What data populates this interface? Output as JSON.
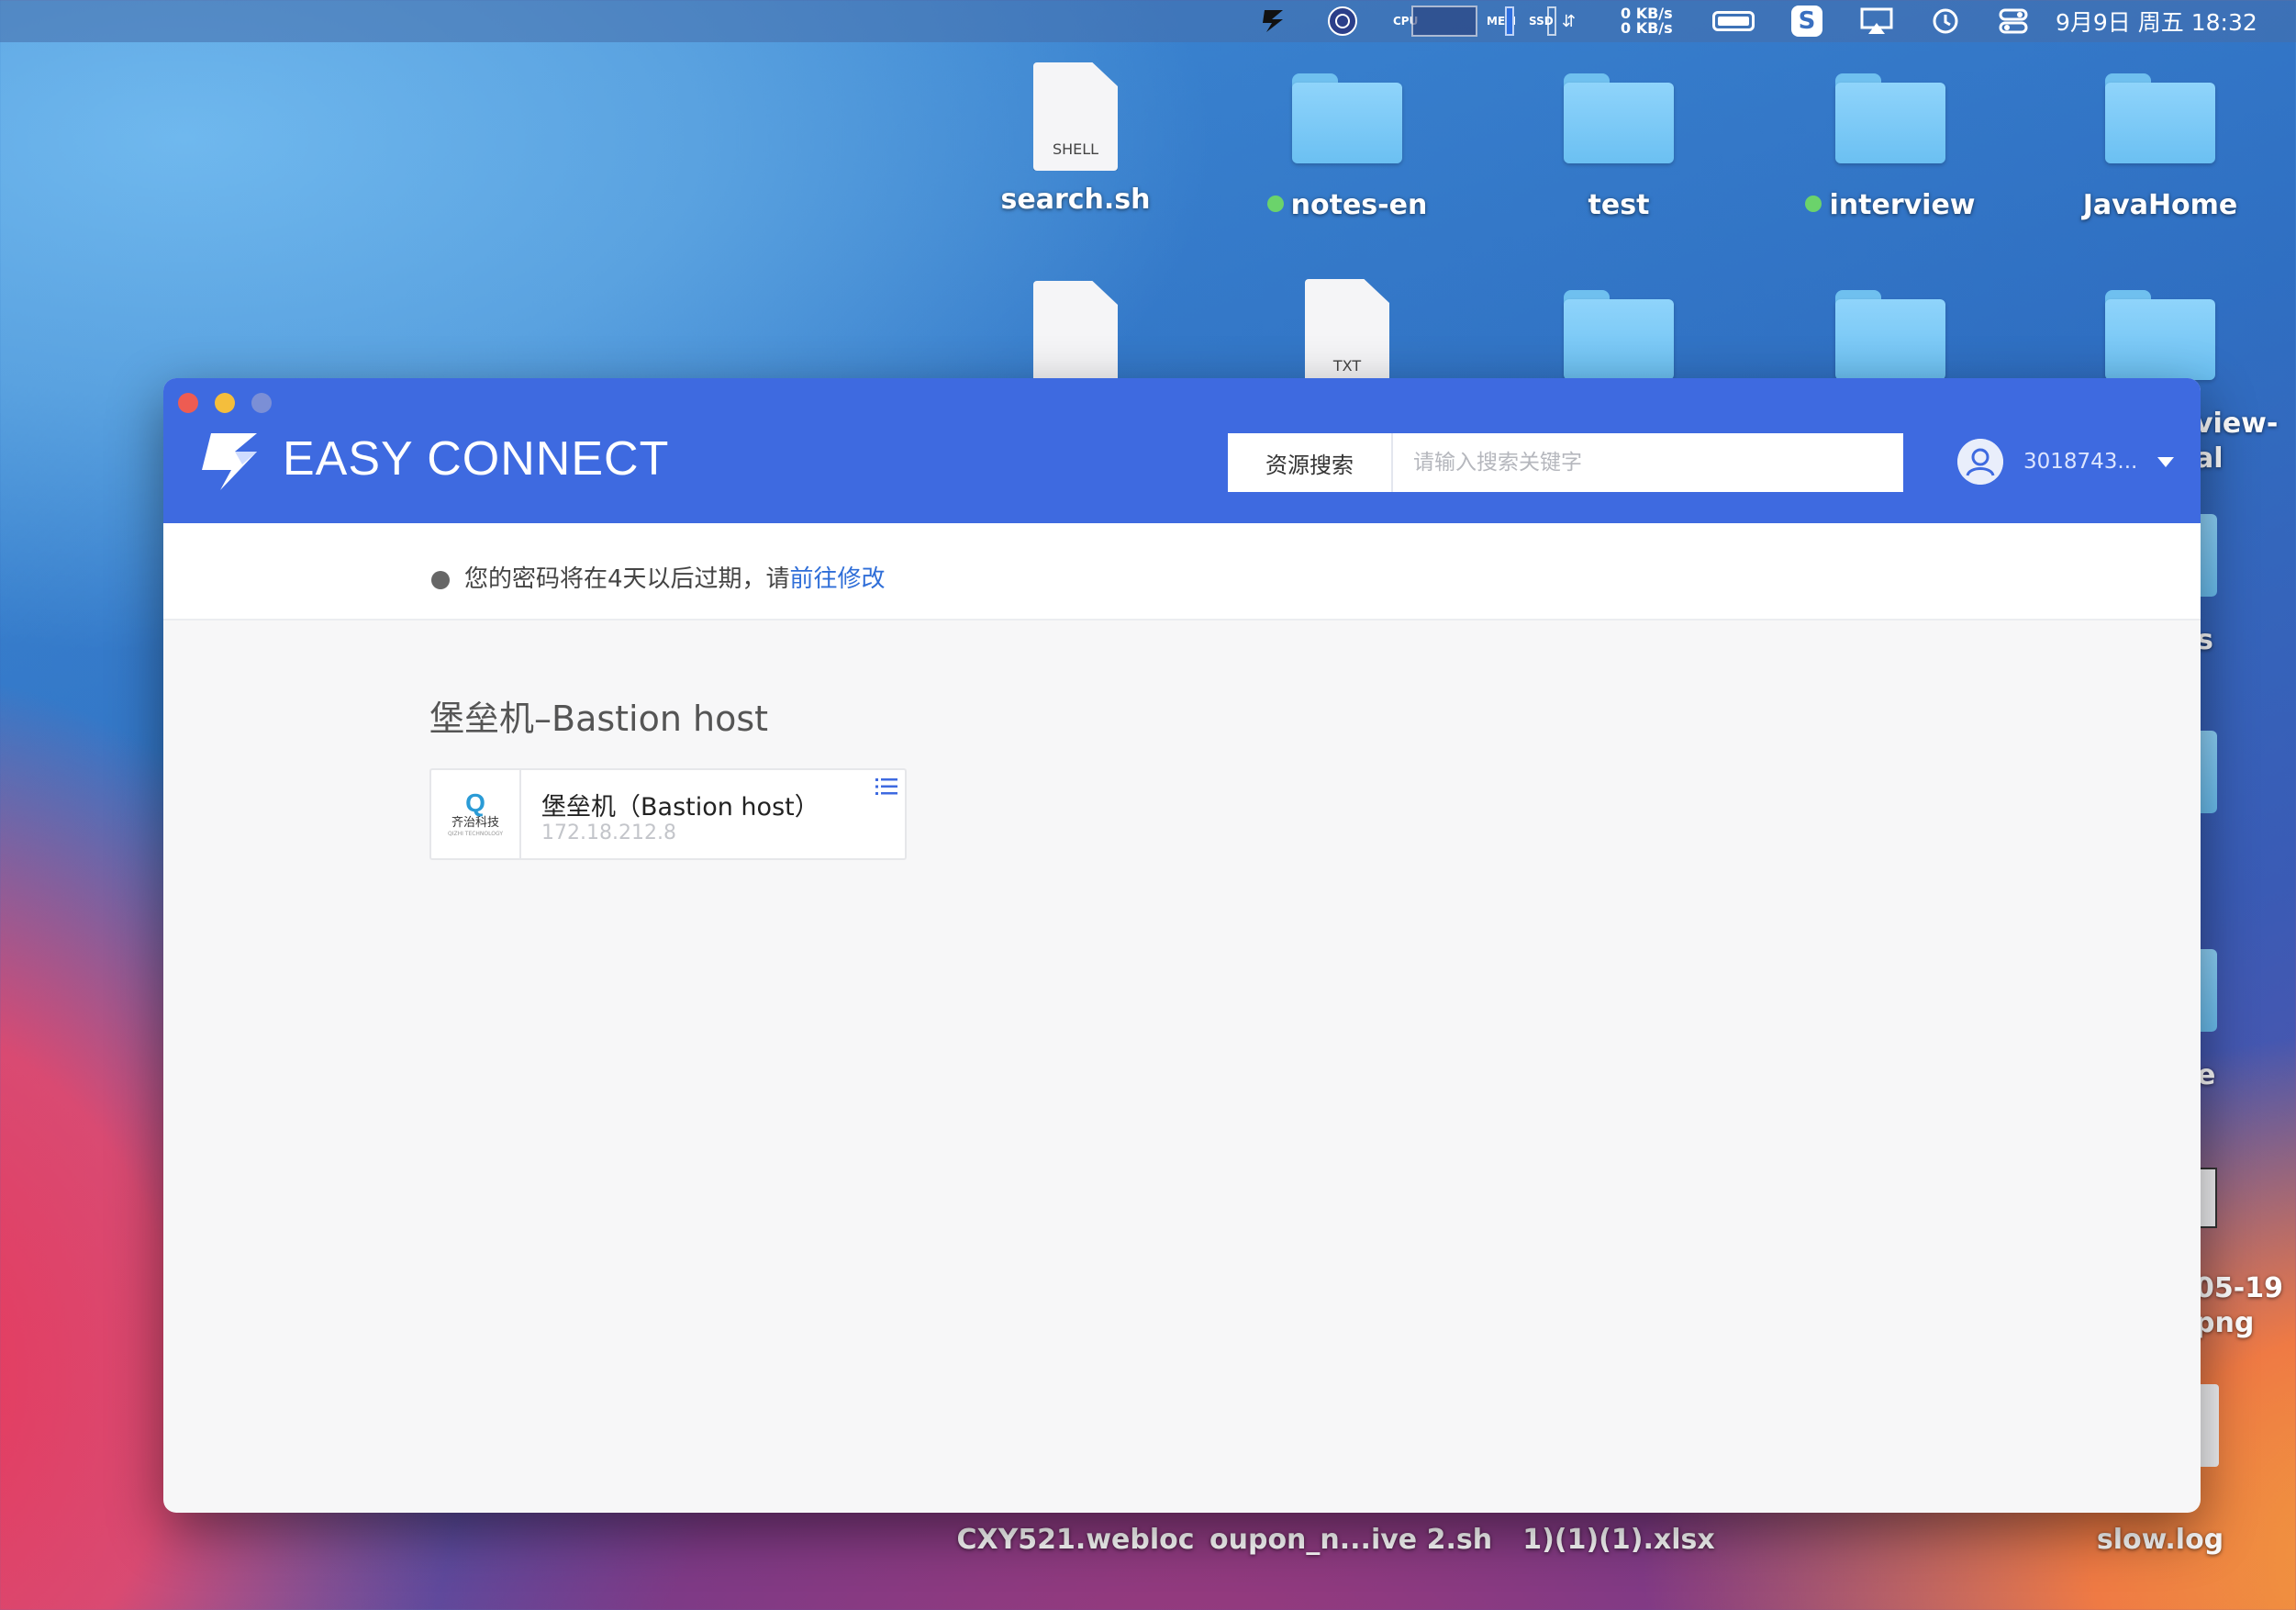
{
  "menubar": {
    "cpu_label": "CPU",
    "mem_label": "MEM",
    "ssd_label": "SSD",
    "net_up": "0 KB/s",
    "net_down": "0 KB/s",
    "ime": "S",
    "datetime": "9月9日 周五  18:32"
  },
  "desktop": {
    "row1": [
      {
        "label": "search.sh",
        "kind": "SHELL",
        "type": "doc",
        "tagged": false
      },
      {
        "label": "notes-en",
        "type": "folder",
        "tagged": true
      },
      {
        "label": "test",
        "type": "folder",
        "tagged": false
      },
      {
        "label": "interview",
        "type": "folder",
        "tagged": true
      },
      {
        "label": "JavaHome",
        "type": "folder",
        "tagged": false
      }
    ],
    "row2_kind": "TXT",
    "bottom_labels": [
      "CXY521.webloc",
      "oupon_n...ive 2.sh",
      "1)(1)(1).xlsx",
      "slow.log"
    ],
    "partial_right": [
      "view-",
      "al",
      "s",
      "e",
      "05-19",
      "png"
    ]
  },
  "window": {
    "brand": "EASY CONNECT",
    "search": {
      "button_label": "资源搜索",
      "placeholder": "请输入搜索关键字",
      "value": ""
    },
    "user": {
      "name": "3018743..."
    },
    "notice": {
      "text": "您的密码将在4天以后过期，请",
      "link": "前往修改"
    },
    "section": {
      "title": "堡垒机–Bastion host",
      "resources": [
        {
          "name": "堡垒机（Bastion host）",
          "address": "172.18.212.8",
          "logo_mark": "Q",
          "logo_text": "齐治科技",
          "logo_sub": "QIZHI TECHNOLOGY"
        }
      ]
    }
  },
  "colors": {
    "header_blue": "#3e6ae0",
    "link_blue": "#2f6ed8",
    "window_bg": "#f7f7f8"
  }
}
